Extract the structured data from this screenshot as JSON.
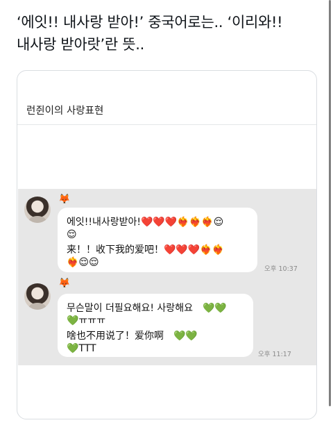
{
  "tweet": {
    "line1": "‘에잇!! 내사랑 받아!’ 중국어로는.. ‘이리와!!",
    "line2": "내사랑 받아랏’란 뜻.."
  },
  "card": {
    "title": "런쥔이의 사랑표현"
  },
  "messages": [
    {
      "sender_icon": "🦊",
      "lines": [
        "에잇!!내사랑받아!❤️❤️❤️❤️‍🔥❤️‍🔥❤️‍🔥😌",
        "😌",
        "来！！收下我的爱吧！❤️❤️❤️❤️‍🔥❤️‍🔥",
        "❤️‍🔥😌😌"
      ],
      "time": "오후 10:37"
    },
    {
      "sender_icon": "🦊",
      "lines": [
        "무슨말이 더필요해요! 사랑해요　💚💚",
        "💚ㅠㅠㅠ",
        "啥也不用说了！爱你啊　💚💚",
        "💚TTT"
      ],
      "time": "오후 11:17"
    }
  ]
}
